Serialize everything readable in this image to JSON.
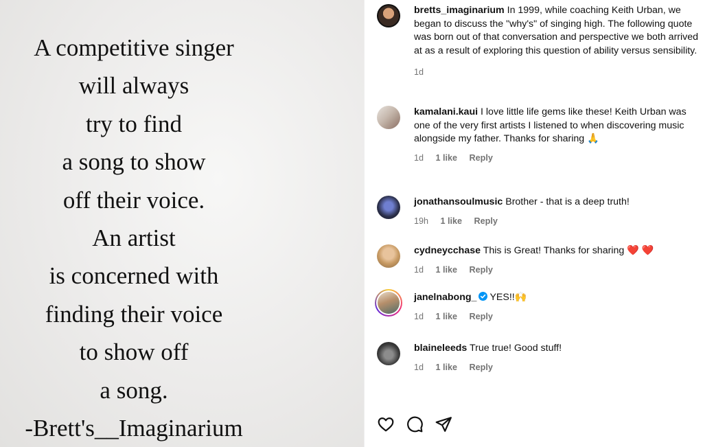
{
  "image": {
    "quote_lines": [
      "A competitive singer",
      "will always",
      "try to find",
      "a song to show",
      "off their voice.",
      "An artist",
      "is concerned with",
      "finding their voice",
      "to show off",
      "a song.",
      "-Brett's__Imaginarium"
    ]
  },
  "caption": {
    "username": "bretts_imaginarium",
    "text": "In 1999, while coaching Keith Urban, we began to discuss the \"why's\" of singing high. The following quote was born out of that conversation and perspective we both arrived at as a result of exploring this question of ability versus sensibility.",
    "time": "1d"
  },
  "comments": [
    {
      "username": "kamalani.kaui",
      "text": "I love little life gems like these! Keith Urban was one of the very first artists I listened to when discovering music alongside my father. Thanks for sharing 🙏",
      "time": "1d",
      "likes": "1 like",
      "reply": "Reply"
    },
    {
      "username": "jonathansoulmusic",
      "text": "Brother - that is a deep truth!",
      "time": "19h",
      "likes": "1 like",
      "reply": "Reply"
    },
    {
      "username": "cydneycchase",
      "text": "This is Great! Thanks for sharing ❤️ ❤️",
      "time": "1d",
      "likes": "1 like",
      "reply": "Reply"
    },
    {
      "username": "janelnabong_",
      "text": "YES!!🙌",
      "time": "1d",
      "likes": "1 like",
      "reply": "Reply",
      "verified": true
    },
    {
      "username": "blaineleeds",
      "text": "True true! Good stuff!",
      "time": "1d",
      "likes": "1 like",
      "reply": "Reply"
    }
  ],
  "actions": {
    "icons": [
      "heart-icon",
      "comment-icon",
      "share-icon"
    ]
  },
  "colors": {
    "verified": "#0095f6",
    "meta": "#737373",
    "story_ring_start": "#f9ce34",
    "story_ring_end": "#ee2a7b"
  }
}
